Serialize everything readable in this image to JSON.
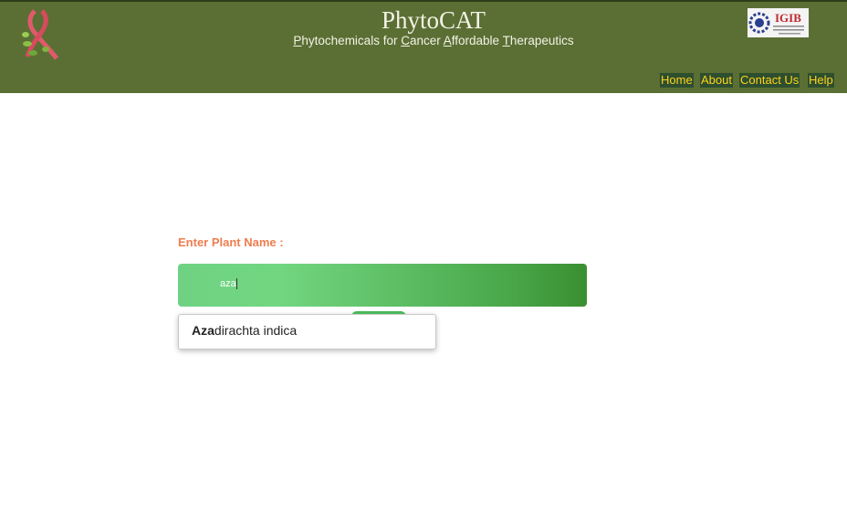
{
  "header": {
    "title": "PhytoCAT",
    "subtitle_parts": [
      {
        "initial": "P",
        "rest": "hytochemicals for "
      },
      {
        "initial": "C",
        "rest": "ancer "
      },
      {
        "initial": "A",
        "rest": "ffordable "
      },
      {
        "initial": "T",
        "rest": "herapeutics"
      }
    ],
    "logo_text": "IGIB"
  },
  "nav": {
    "home": "Home",
    "about": "About",
    "contact": "Contact Us",
    "help": "Help"
  },
  "search": {
    "label": "Enter Plant Name :",
    "value": "aza"
  },
  "autocomplete": {
    "match": "Aza",
    "rest": "dirachta indica"
  },
  "colors": {
    "header_bg": "#5b6f34",
    "nav_text": "#ffd21a",
    "label": "#ef7d4f"
  }
}
